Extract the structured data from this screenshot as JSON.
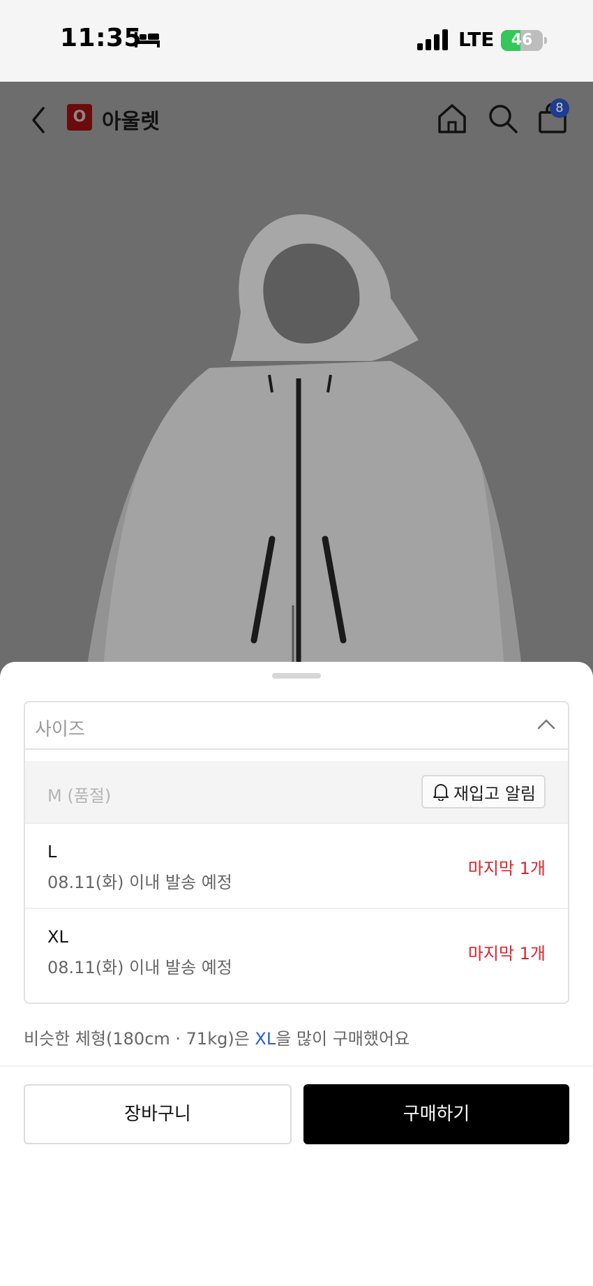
{
  "status_bar": {
    "time": "11:35",
    "network": "LTE",
    "battery_percent": 46,
    "battery_label": "46"
  },
  "nav": {
    "brand_logo_letter": "O",
    "brand_name": "아울렛",
    "cart_count": "8"
  },
  "size_selector": {
    "label": "사이즈",
    "options": [
      {
        "size": "M (품절)",
        "soldout": true,
        "action_label": "재입고 알림"
      },
      {
        "size": "L",
        "shipping": "08.11(화) 이내 발송 예정",
        "stock": "마지막 1개"
      },
      {
        "size": "XL",
        "shipping": "08.11(화) 이내 발송 예정",
        "stock": "마지막 1개"
      }
    ]
  },
  "recommendation": {
    "prefix": "비슷한 체형(180cm · 71kg)은 ",
    "highlight": "XL",
    "suffix": "을 많이 구매했어요"
  },
  "actions": {
    "cart_label": "장바구니",
    "buy_label": "구매하기"
  },
  "colors": {
    "accent_red": "#e0242c",
    "link_blue": "#2a5bd7",
    "buy_button": "#000000",
    "battery_green": "#34c759"
  }
}
